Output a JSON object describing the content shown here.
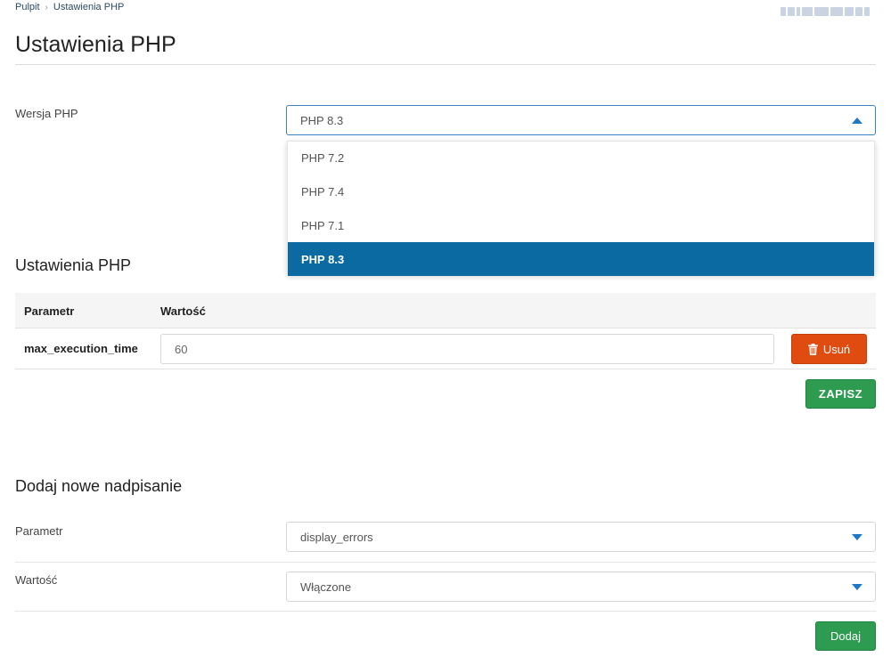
{
  "breadcrumb": {
    "home": "Pulpit",
    "separator": "›",
    "current": "Ustawienia PHP"
  },
  "page_title": "Ustawienia PHP",
  "php_version": {
    "label": "Wersja PHP",
    "selected": "PHP 8.3",
    "options": [
      "PHP 7.2",
      "PHP 7.4",
      "PHP 7.1",
      "PHP 8.3"
    ]
  },
  "settings": {
    "title": "Ustawienia PHP",
    "columns": [
      "Parametr",
      "Wartość"
    ],
    "rows": [
      {
        "param": "max_execution_time",
        "value": "60"
      }
    ],
    "delete_label": "Usuń",
    "save_label": "ZAPISZ"
  },
  "new_override": {
    "title": "Dodaj nowe nadpisanie",
    "param_label": "Parametr",
    "param_value": "display_errors",
    "value_label": "Wartość",
    "value_value": "Włączone",
    "add_label": "Dodaj"
  },
  "icons": {
    "dropdown_open": "caret-up-icon",
    "dropdown_closed": "caret-down-icon",
    "delete": "trash-icon"
  },
  "colors": {
    "primary": "#0b6aa2",
    "accent": "#1e78c8",
    "danger": "#e04b10",
    "success": "#2e9c50"
  }
}
